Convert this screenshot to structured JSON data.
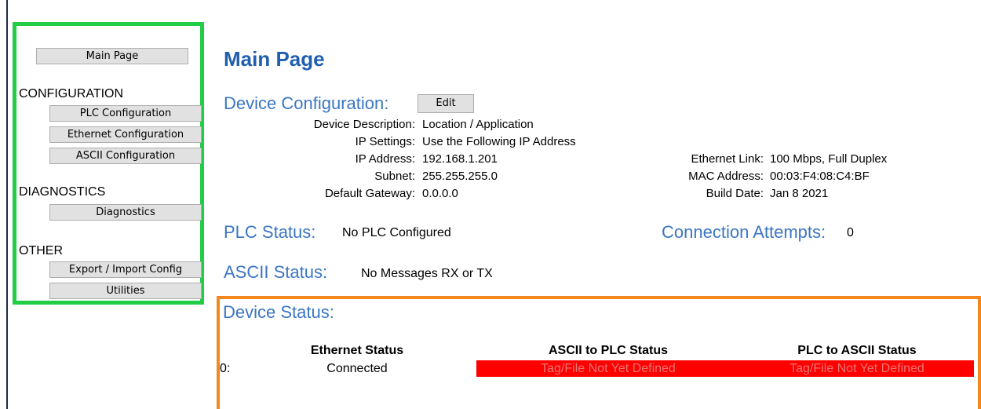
{
  "sidebar": {
    "main_page": "Main Page",
    "configuration_heading": "CONFIGURATION",
    "plc_configuration": "PLC Configuration",
    "ethernet_configuration": "Ethernet Configuration",
    "ascii_configuration": "ASCII Configuration",
    "diagnostics_heading": "DIAGNOSTICS",
    "diagnostics": "Diagnostics",
    "other_heading": "OTHER",
    "export_import": "Export / Import Config",
    "utilities": "Utilities"
  },
  "main": {
    "title": "Main Page",
    "device_configuration": {
      "heading": "Device Configuration:",
      "edit_label": "Edit",
      "fields": [
        {
          "label": "Device Description:",
          "value": "Location / Application"
        },
        {
          "label": "IP Settings:",
          "value": "Use the Following IP Address"
        },
        {
          "label": "IP Address:",
          "value": "192.168.1.201"
        },
        {
          "label": "Subnet:",
          "value": "255.255.255.0"
        },
        {
          "label": "Default Gateway:",
          "value": "0.0.0.0"
        }
      ],
      "right_fields": [
        {
          "label": "Ethernet Link:",
          "value": "100 Mbps, Full Duplex"
        },
        {
          "label": "MAC Address:",
          "value": "00:03:F4:08:C4:BF"
        },
        {
          "label": "Build Date:",
          "value": "Jan 8 2021"
        }
      ]
    },
    "plc_status": {
      "heading": "PLC Status:",
      "value": "No PLC Configured"
    },
    "connection_attempts": {
      "heading": "Connection Attempts:",
      "value": "0"
    },
    "ascii_status": {
      "heading": "ASCII Status:",
      "value": "No Messages RX or TX"
    },
    "device_status": {
      "heading": "Device Status:",
      "columns": [
        "Ethernet Status",
        "ASCII to PLC Status",
        "PLC to ASCII Status"
      ],
      "rows": [
        {
          "index": "0:",
          "ethernet": "Connected",
          "ascii_to_plc": "Tag/File Not Yet Defined",
          "plc_to_ascii": "Tag/File Not Yet Defined"
        }
      ]
    }
  },
  "colors": {
    "sidebar_highlight": "#22cc44",
    "status_highlight": "#f5871f",
    "heading_blue": "#3a76c4",
    "error_red": "#ff0000"
  }
}
